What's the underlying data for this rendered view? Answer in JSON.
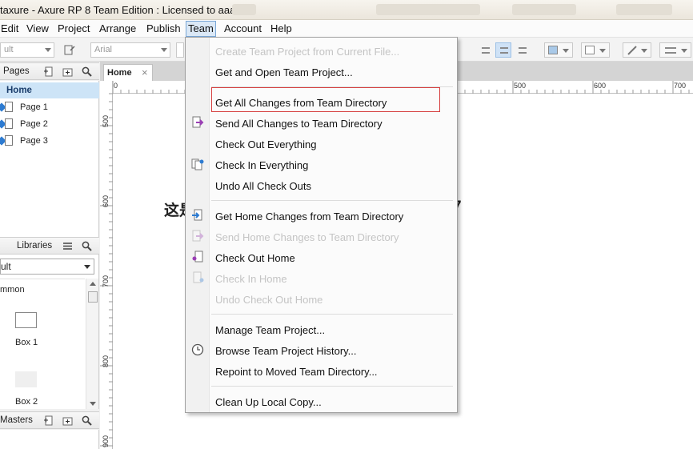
{
  "window": {
    "title": "taxure - Axure RP 8 Team Edition : Licensed to aaa"
  },
  "menubar": {
    "items": [
      "Edit",
      "View",
      "Project",
      "Arrange",
      "Publish",
      "Team",
      "Account",
      "Help"
    ],
    "active": "Team"
  },
  "toolbar": {
    "style_combo": "ult",
    "font_combo": "Arial"
  },
  "pages_pane": {
    "title": "Pages",
    "pages": [
      "Home",
      "Page 1",
      "Page 2",
      "Page 3"
    ],
    "selected": "Home"
  },
  "libraries_pane": {
    "title": "Libraries",
    "library_select": "ult",
    "section": "mmon",
    "widgets": [
      "Box 1",
      "Box 2"
    ]
  },
  "masters_pane": {
    "title": "Masters"
  },
  "editor": {
    "tab_label": "Home",
    "tab_close": "×",
    "canvas_text_left": "这是",
    "canvas_text_right": "7",
    "ruler_h_labels": [
      "0",
      "500",
      "600",
      "700"
    ],
    "ruler_v_labels": [
      "500",
      "600",
      "700",
      "800",
      "900"
    ]
  },
  "team_menu": {
    "items": [
      {
        "label": "Create Team Project from Current File...",
        "enabled": false,
        "icon": ""
      },
      {
        "label": "Get and Open Team Project...",
        "enabled": true,
        "icon": ""
      },
      {
        "label": "Get All Changes from Team Directory",
        "enabled": true,
        "icon": "",
        "highlighted": true
      },
      {
        "label": "Send All Changes to Team Directory",
        "enabled": true,
        "icon": "send-changes-icon"
      },
      {
        "label": "Check Out Everything",
        "enabled": true,
        "icon": ""
      },
      {
        "label": "Check In Everything",
        "enabled": true,
        "icon": "check-in-icon"
      },
      {
        "label": "Undo All Check Outs",
        "enabled": true,
        "icon": ""
      },
      {
        "label": "Get Home Changes from Team Directory",
        "enabled": true,
        "icon": "get-changes-icon"
      },
      {
        "label": "Send Home Changes to Team Directory",
        "enabled": false,
        "icon": "send-changes-icon"
      },
      {
        "label": "Check Out Home",
        "enabled": true,
        "icon": "check-out-icon"
      },
      {
        "label": "Check In Home",
        "enabled": false,
        "icon": "check-in-icon"
      },
      {
        "label": "Undo Check Out Home",
        "enabled": false,
        "icon": ""
      },
      {
        "label": "Manage Team Project...",
        "enabled": true,
        "icon": ""
      },
      {
        "label": "Browse Team Project History...",
        "enabled": true,
        "icon": "clock-icon"
      },
      {
        "label": "Repoint to Moved Team Directory...",
        "enabled": true,
        "icon": ""
      },
      {
        "label": "Clean Up Local Copy...",
        "enabled": true,
        "icon": ""
      }
    ]
  },
  "colors": {
    "accent": "#2d7bd1",
    "highlight_border": "#d64040",
    "selection": "#cde4f7"
  }
}
